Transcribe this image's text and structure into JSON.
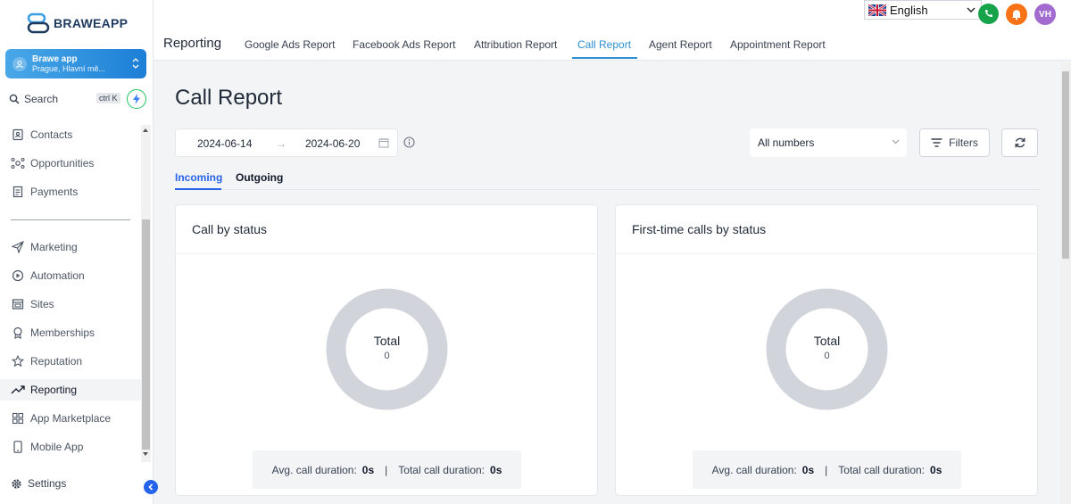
{
  "sidebar": {
    "logo": "BRAWEAPP",
    "account": {
      "name": "Brawe app",
      "location": "Prague, Hlavní mě..."
    },
    "search": {
      "label": "Search",
      "shortcut": "ctrl K"
    },
    "items_top": [
      {
        "label": "Contacts",
        "icon": "contacts-icon"
      },
      {
        "label": "Opportunities",
        "icon": "opportunities-icon"
      },
      {
        "label": "Payments",
        "icon": "payments-icon"
      }
    ],
    "items": [
      {
        "label": "Marketing",
        "icon": "send-icon"
      },
      {
        "label": "Automation",
        "icon": "automation-icon"
      },
      {
        "label": "Sites",
        "icon": "sites-icon"
      },
      {
        "label": "Memberships",
        "icon": "badge-icon"
      },
      {
        "label": "Reputation",
        "icon": "star-icon"
      },
      {
        "label": "Reporting",
        "icon": "trend-icon",
        "active": true
      },
      {
        "label": "App Marketplace",
        "icon": "grid-icon"
      },
      {
        "label": "Mobile App",
        "icon": "mobile-icon"
      }
    ],
    "settings": "Settings"
  },
  "header": {
    "title": "Reporting",
    "tabs": [
      {
        "label": "Google Ads Report"
      },
      {
        "label": "Facebook Ads Report"
      },
      {
        "label": "Attribution Report"
      },
      {
        "label": "Call Report",
        "active": true
      },
      {
        "label": "Agent Report"
      },
      {
        "label": "Appointment Report"
      }
    ],
    "language": "English",
    "user_initials": "VH"
  },
  "main": {
    "title": "Call Report",
    "date_from": "2024-06-14",
    "date_arrow": "→",
    "date_to": "2024-06-20",
    "numbers_select": "All numbers",
    "filters_label": "Filters",
    "subtabs": [
      {
        "label": "Incoming",
        "active": true
      },
      {
        "label": "Outgoing"
      }
    ],
    "cards": [
      {
        "title": "Call by status",
        "total_label": "Total",
        "total_value": "0",
        "avg_label": "Avg. call duration:",
        "avg_value": "0s",
        "separator": "|",
        "total_duration_label": "Total call duration:",
        "total_duration_value": "0s"
      },
      {
        "title": "First-time calls by status",
        "total_label": "Total",
        "total_value": "0",
        "avg_label": "Avg. call duration:",
        "avg_value": "0s",
        "separator": "|",
        "total_duration_label": "Total call duration:",
        "total_duration_value": "0s"
      }
    ]
  },
  "colors": {
    "accent": "#2d8fcf",
    "donut": "#d1d5db",
    "account_gradient_start": "#4aa8e8",
    "account_gradient_end": "#1c7fd6"
  }
}
